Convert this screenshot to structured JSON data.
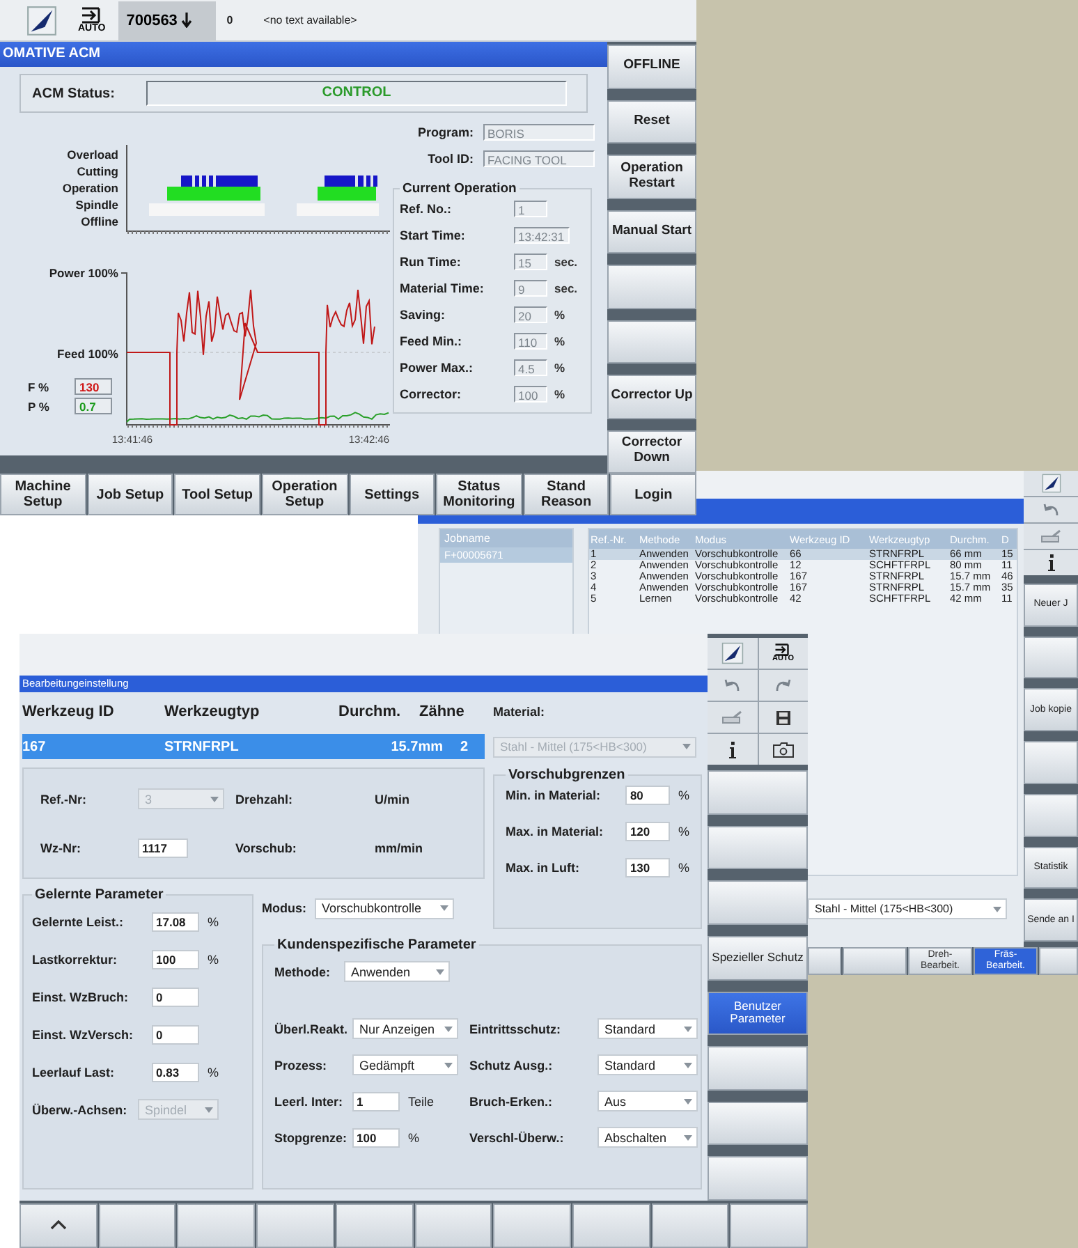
{
  "acm": {
    "header": {
      "mode": "AUTO",
      "program": "700563",
      "channel": "0",
      "message": "<no text available>"
    },
    "title": "OMATIVE ACM",
    "status": {
      "label": "ACM Status:",
      "value": "CONTROL"
    },
    "timeline_labels": [
      "Overload",
      "Cutting",
      "Operation",
      "Spindle",
      "Offline"
    ],
    "trend": {
      "power_label": "Power 100%",
      "feed_label": "Feed 100%",
      "start_time": "13:41:46",
      "end_time": "13:42:46"
    },
    "readouts": [
      {
        "label": "F %",
        "value": "130",
        "color": "#d01818"
      },
      {
        "label": "P %",
        "value": "0.7",
        "color": "#1a9a1a"
      }
    ],
    "program": {
      "label": "Program:",
      "value": "BORIS"
    },
    "tool": {
      "label": "Tool ID:",
      "value": "FACING TOOL"
    },
    "current_operation": {
      "title": "Current Operation",
      "rows": [
        {
          "label": "Ref. No.:",
          "value": "1"
        },
        {
          "label": "Start Time:",
          "value": "13:42:31"
        },
        {
          "label": "Run Time:",
          "value": "15",
          "unit": "sec."
        },
        {
          "label": "Material Time:",
          "value": "9",
          "unit": "sec."
        },
        {
          "label": "Saving:",
          "value": "20",
          "unit": "%"
        },
        {
          "label": "Feed Min.:",
          "value": "110",
          "unit": "%"
        },
        {
          "label": "Power Max.:",
          "value": "4.5",
          "unit": "%"
        },
        {
          "label": "Corrector:",
          "value": "100",
          "unit": "%"
        }
      ]
    },
    "side_buttons": [
      {
        "kind": "labeled",
        "label": "OFFLINE"
      },
      {
        "kind": "labeled",
        "label": "Reset"
      },
      {
        "kind": "labeled",
        "label": "Operation Restart"
      },
      {
        "kind": "labeled",
        "label": "Manual Start"
      },
      {
        "kind": "blank"
      },
      {
        "kind": "blank"
      },
      {
        "kind": "labeled",
        "label": "Corrector Up"
      },
      {
        "kind": "labeled",
        "label": "Corrector Down"
      }
    ],
    "bottom_buttons": [
      "Machine Setup",
      "Job Setup",
      "Tool Setup",
      "Operation Setup",
      "Settings",
      "Status Monitoring",
      "Stand Reason",
      "Login"
    ]
  },
  "jobs": {
    "list_header": "Jobname",
    "list_items": [
      {
        "text": "F+00005671",
        "selected": true
      }
    ],
    "columns": [
      "Ref.-Nr.",
      "Methode",
      "Modus",
      "Werkzeug ID",
      "Werkzeugtyp",
      "Durchm.",
      "D"
    ],
    "rows": [
      {
        "cells": [
          "1",
          "Anwenden",
          "Vorschubkontrolle",
          "66",
          "STRNFRPL",
          "66 mm",
          "15"
        ],
        "selected": true
      },
      {
        "cells": [
          "2",
          "Anwenden",
          "Vorschubkontrolle",
          "12",
          "SCHFTFRPL",
          "80 mm",
          "11"
        ],
        "selected": false
      },
      {
        "cells": [
          "3",
          "Anwenden",
          "Vorschubkontrolle",
          "167",
          "STRNFRPL",
          "15.7 mm",
          "46"
        ],
        "selected": false
      },
      {
        "cells": [
          "4",
          "Anwenden",
          "Vorschubkontrolle",
          "167",
          "STRNFRPL",
          "15.7 mm",
          "35"
        ],
        "selected": false
      },
      {
        "cells": [
          "5",
          "Lernen",
          "Vorschubkontrolle",
          "42",
          "SCHFTFRPL",
          "42 mm",
          "11"
        ],
        "selected": false
      }
    ],
    "material": "Stahl - Mittel (175<HB<300)",
    "side_buttons": [
      {
        "kind": "labeled",
        "label": "Neuer J"
      },
      {
        "kind": "blank"
      },
      {
        "kind": "labeled",
        "label": "Job kopie"
      },
      {
        "kind": "blank"
      },
      {
        "kind": "blank"
      },
      {
        "kind": "labeled",
        "label": "Statistik"
      },
      {
        "kind": "labeled",
        "label": "Sende an I"
      }
    ],
    "tabs": [
      {
        "label": "Dreh-Bearbeit.",
        "selected": false
      },
      {
        "label": "Fräs-Bearbeit.",
        "selected": true
      }
    ]
  },
  "setup": {
    "title": "Bearbeitungeinstellung",
    "mode": "AUTO",
    "tool_columns": [
      "Werkzeug ID",
      "Werkzeugtyp",
      "Durchm.",
      "Zähne"
    ],
    "tool_row": {
      "cells": [
        "167",
        "STRNFRPL",
        "15.7mm",
        "2"
      ],
      "selected": true
    },
    "material": {
      "label": "Material:",
      "value": "Stahl - Mittel (175<HB<300)",
      "disabled": true
    },
    "tool_fields": [
      {
        "kind": "dropdown",
        "label": "Ref.-Nr:",
        "value": "3",
        "disabled": true
      },
      {
        "kind": "unit",
        "label": "Drehzahl:",
        "unit": "U/min",
        "disabled": false
      },
      {
        "kind": "input",
        "label": "Wz-Nr:",
        "value": "1117",
        "disabled": false
      },
      {
        "kind": "unit",
        "label": "Vorschub:",
        "unit": "mm/min",
        "disabled": false
      }
    ],
    "feed_limits": {
      "title": "Vorschubgrenzen",
      "rows": [
        {
          "label": "Min. in Material:",
          "value": "80",
          "unit": "%"
        },
        {
          "label": "Max. in Material:",
          "value": "120",
          "unit": "%"
        },
        {
          "label": "Max. in Luft:",
          "value": "130",
          "unit": "%"
        }
      ]
    },
    "learned": {
      "title": "Gelernte Parameter",
      "rows": [
        {
          "kind": "input",
          "label": "Gelernte Leist.:",
          "value": "17.08",
          "unit": "%",
          "disabled": false
        },
        {
          "kind": "input",
          "label": "Lastkorrektur:",
          "value": "100",
          "unit": "%",
          "disabled": false
        },
        {
          "kind": "input",
          "label": "Einst. WzBruch:",
          "value": "0",
          "disabled": false
        },
        {
          "kind": "input",
          "label": "Einst. WzVersch:",
          "value": "0",
          "disabled": false
        },
        {
          "kind": "input",
          "label": "Leerlauf Last:",
          "value": "0.83",
          "unit": "%",
          "disabled": false
        },
        {
          "kind": "dropdown",
          "label": "Überw.-Achsen:",
          "value": "Spindel",
          "disabled": true
        }
      ]
    },
    "mode_field": {
      "label": "Modus:",
      "value": "Vorschubkontrolle"
    },
    "custom": {
      "title": "Kundenspezifische Parameter",
      "method": {
        "label": "Methode:",
        "value": "Anwenden"
      },
      "rows": [
        {
          "kind": "dropdown",
          "label": "Überl.Reakt.",
          "value": "Nur Anzeigen"
        },
        {
          "kind": "dropdown",
          "label": "Eintrittsschutz:",
          "value": "Standard"
        },
        {
          "kind": "dropdown",
          "label": "Prozess:",
          "value": "Gedämpft"
        },
        {
          "kind": "dropdown",
          "label": "Schutz Ausg.:",
          "value": "Standard"
        },
        {
          "kind": "input",
          "label": "Leerl. Inter:",
          "value": "1",
          "unit": "Teile"
        },
        {
          "kind": "dropdown",
          "label": "Bruch-Erken.:",
          "value": "Aus"
        },
        {
          "kind": "input",
          "label": "Stopgrenze:",
          "value": "100",
          "unit": "%"
        },
        {
          "kind": "dropdown",
          "label": "Verschl-Überw.:",
          "value": "Abschalten"
        }
      ]
    },
    "side_buttons": [
      {
        "selected": false
      },
      {
        "selected": false
      },
      {
        "selected": false
      },
      {
        "label": "Spezieller Schutz",
        "selected": false
      },
      {
        "label": "Benutzer Parameter",
        "selected": true
      },
      {
        "selected": false
      },
      {
        "selected": false
      },
      {
        "selected": false
      }
    ]
  }
}
